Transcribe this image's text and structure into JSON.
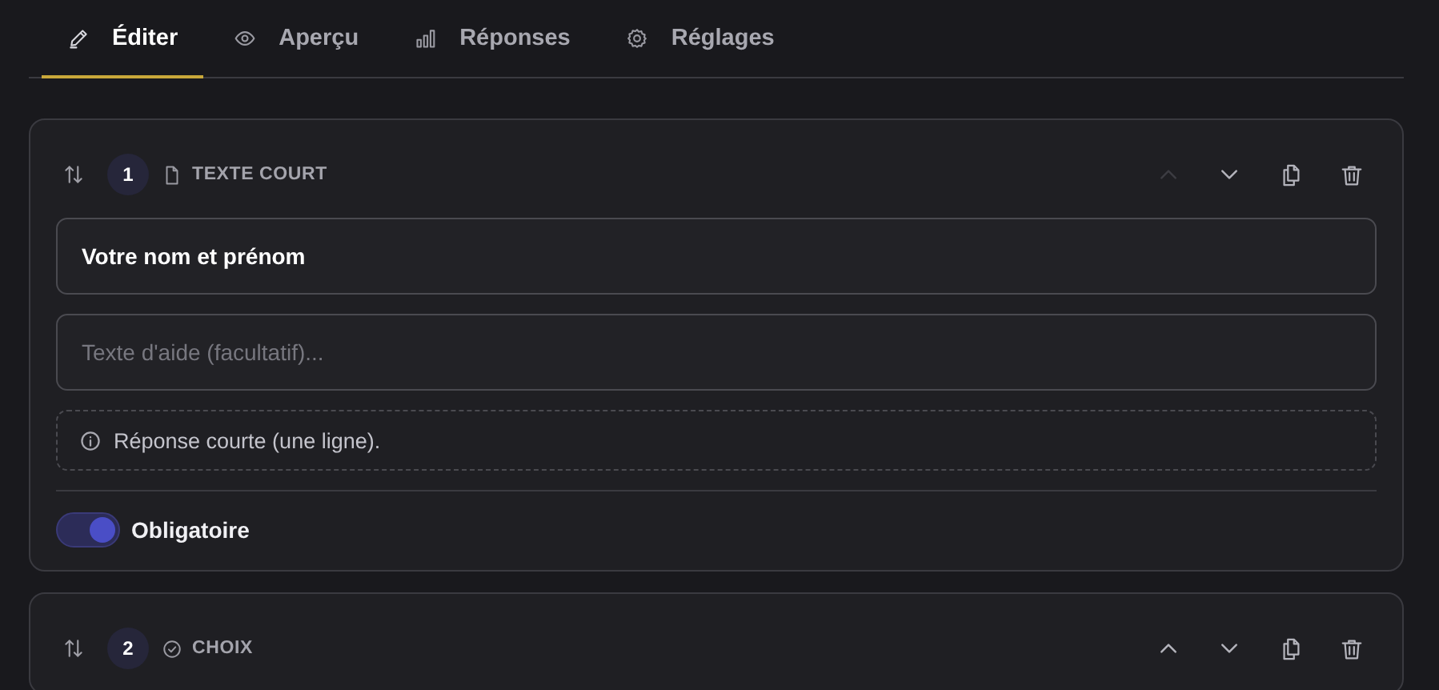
{
  "tabs": [
    {
      "label": "Éditer",
      "selected": true
    },
    {
      "label": "Aperçu",
      "selected": false
    },
    {
      "label": "Réponses",
      "selected": false
    },
    {
      "label": "Réglages",
      "selected": false
    }
  ],
  "questions": [
    {
      "number": "1",
      "type_label": "TEXTE COURT",
      "kind": "short-text",
      "move_up_disabled": true,
      "move_down_disabled": false,
      "title": "Votre nom et prénom",
      "help_placeholder": "Texte d'aide (facultatif)...",
      "note": "Réponse courte (une ligne).",
      "required": {
        "label": "Obligatoire",
        "on": true
      }
    },
    {
      "number": "2",
      "type_label": "CHOIX",
      "kind": "choice",
      "move_up_disabled": false,
      "move_down_disabled": false
    }
  ]
}
